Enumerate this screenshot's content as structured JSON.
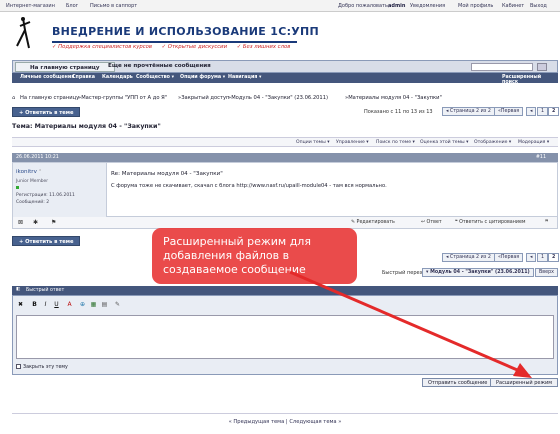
{
  "topbar": {
    "links": [
      "Интернет-магазин",
      "Блог",
      "Письмо в саппорт"
    ],
    "welcome": "Добро пожаловать,",
    "user": "admin",
    "notifications": "Уведомления",
    "profile": "Мой профиль",
    "cabinet": "Кабинет",
    "logout": "Выход"
  },
  "brand": {
    "title": "ВНЕДРЕНИЕ И ИСПОЛЬЗОВАНИЕ 1С:УПП",
    "tags": [
      "Поддержка специалистов курсов",
      "Открытые дискуссии",
      "Без лишних слов"
    ]
  },
  "nav": {
    "home": "На главную страницу",
    "unread": "Еще не прочтённые сообщения",
    "advanced_search": "Расширенный поиск",
    "items": [
      "Личные сообщения",
      "Справка",
      "Календарь",
      "Сообщество ▾",
      "Опции форума ▾",
      "Навигация ▾"
    ]
  },
  "breadcrumbs": {
    "parts": [
      "На главную страницу",
      "Мастер-группы \"УПП от А до Я\"",
      "Закрытый доступ",
      "Модуль 04 - \"Закупки\" (23.06.2011)",
      "Материалы модуля 04 - \"Закупки\""
    ]
  },
  "thread": {
    "reply_button": "+ Ответить в теме",
    "shown": "Показано с 11 по 13 из 13",
    "page_label": "◂ Страница 2 из 2",
    "first": "«Первая",
    "prev": "◂",
    "pages": [
      "1",
      "2"
    ],
    "title": "Тема: Материалы модуля 04 - \"Закупки\""
  },
  "tools": [
    "Опции темы ▾",
    "Управление ▾",
    "Поиск по теме ▾",
    "Оценка этой темы ▾",
    "Отображение ▾",
    "Модерация ▾"
  ],
  "post": {
    "date": "26.06.2011 10:21",
    "number": "#11",
    "username": "ikonitrv",
    "rank": "Junior Member",
    "registered_label": "Регистрация:",
    "registered": "11.06.2011",
    "posts_label": "Сообщений:",
    "posts": "2",
    "subject": "Re: Материалы модуля 04 - \"Закупки\"",
    "text": "С форума тоже не скачивает, скачал с блога http://www.nasf.ru/upaill-module04 - там вся нормально.",
    "edit": "Редактировать",
    "reply": "Ответ",
    "reply_quote": "Ответить с цитированием"
  },
  "bottom_pager": {
    "page_label": "◂ Страница 2 из 2",
    "first": "«Первая",
    "prev": "◂",
    "pages": [
      "1",
      "2"
    ],
    "quick_nav": "Быстрый переход",
    "quick_nav_value": "▾ Модуль 04 - \"Закупки\" (23.06.2011)",
    "up": "Вверх"
  },
  "callout": {
    "text": "Расширенный режим для добавления файлов в создаваемое сообщение"
  },
  "quick_reply": {
    "header": "Быстрый ответ",
    "toolbar": [
      "B",
      "I",
      "U",
      "A",
      "⊕",
      "▦",
      "▤",
      "✎"
    ],
    "subscribe": "Закрыть эту тему",
    "submit": "Отправить сообщение",
    "advanced": "Расширенный режим"
  },
  "footer": {
    "prev_thread": "« Предыдущая тема",
    "sep": "|",
    "next_thread": "Следующая тема »"
  },
  "colors": {
    "nav_dark": "#44567c",
    "callout": "#e83c3c",
    "arrow": "#e42a2a"
  }
}
